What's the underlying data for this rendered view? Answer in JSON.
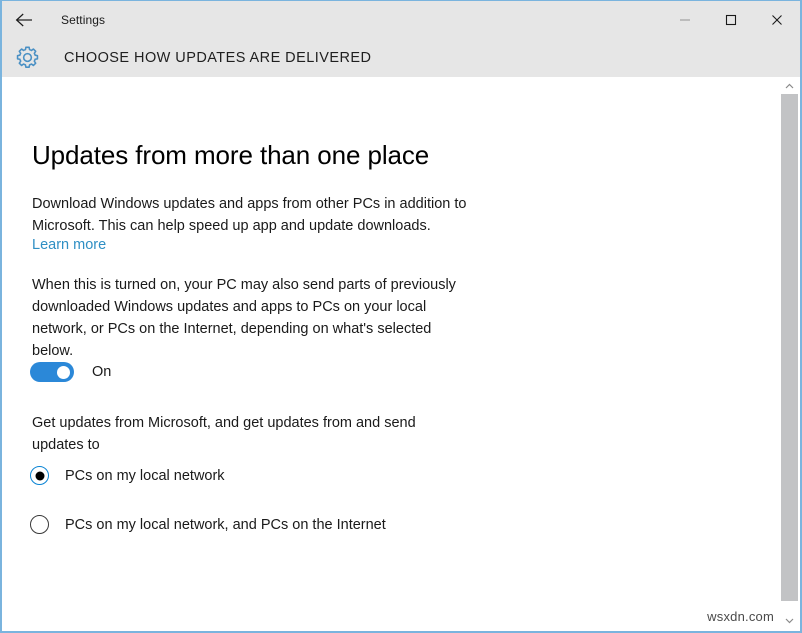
{
  "window": {
    "titlebar_title": "Settings",
    "back_icon": "back-arrow-icon",
    "minimize_label": "–",
    "maximize_label": "□",
    "close_label": "✕",
    "border_color": "#7ab4de",
    "chrome_background": "#e6e6e6"
  },
  "header": {
    "icon": "gear-icon",
    "icon_color": "#4a90c4",
    "title": "CHOOSE HOW UPDATES ARE DELIVERED"
  },
  "main": {
    "heading": "Updates from more than one place",
    "paragraph_1": "Download Windows updates and apps from other PCs in addition to Microsoft. This can help speed up app and update downloads.",
    "learn_more_link": "Learn more",
    "learn_more_color": "#2f8fc4",
    "paragraph_2": "When this is turned on, your PC may also send parts of previously downloaded Windows updates and apps to PCs on your local network, or PCs on the Internet, depending on what's selected below.",
    "toggle": {
      "state_label": "On",
      "checked": true,
      "on_color": "#2b88d8",
      "knob_color": "#ffffff"
    },
    "radio_intro": "Get updates from Microsoft, and get updates from and send updates to",
    "radio_options": [
      {
        "label": "PCs on my local network",
        "selected": true
      },
      {
        "label": "PCs on my local network, and PCs on the Internet",
        "selected": false
      }
    ],
    "radio_selected_ring_color": "#0a84d4",
    "radio_dot_color": "#000000"
  },
  "annotation": {
    "arrow_color": "#d83b2e",
    "arrow_name": "red-pointer-arrow"
  },
  "scrollbar": {
    "up_arrow": "˄",
    "down_arrow": "˅",
    "thumb_color": "#c2c3c5"
  },
  "watermark": {
    "text": "wsxdn.com"
  }
}
